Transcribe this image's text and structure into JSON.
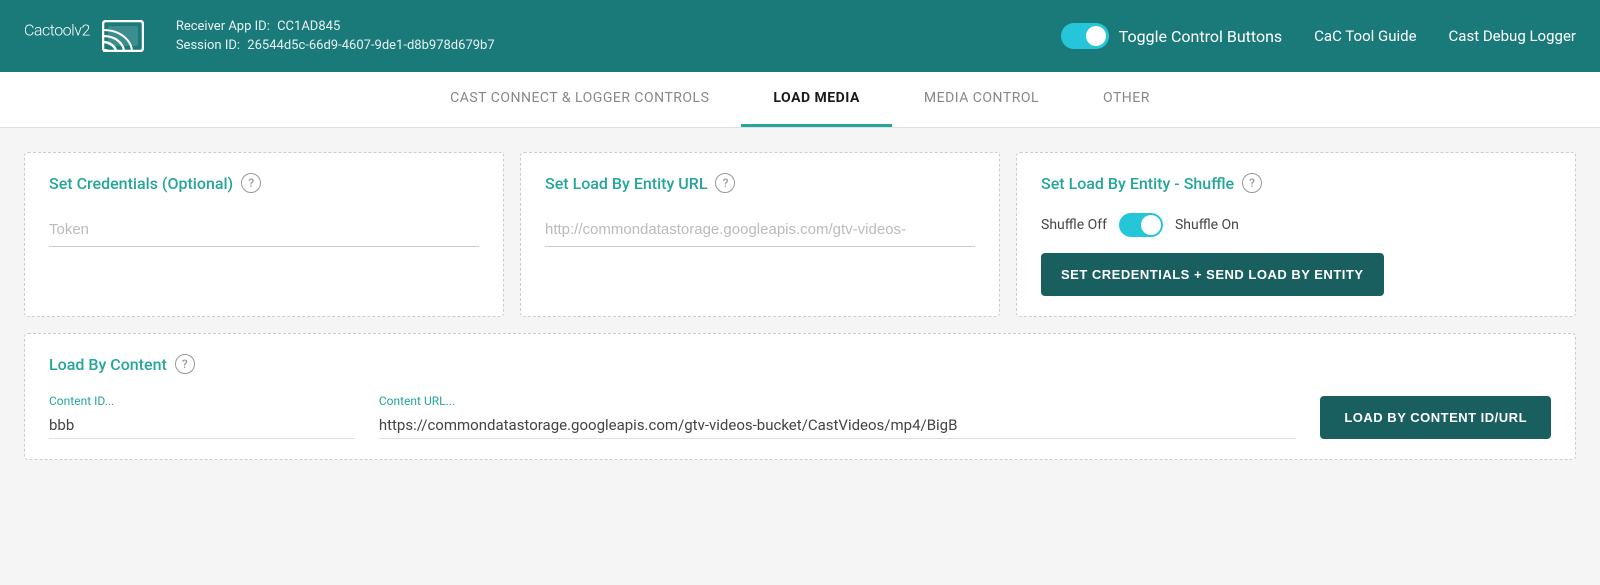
{
  "header": {
    "logo_text": "Cactool",
    "logo_version": "v2",
    "receiver_app_label": "Receiver App ID:",
    "receiver_app_id": "CC1AD845",
    "session_label": "Session ID:",
    "session_id": "26544d5c-66d9-4607-9de1-d8b978d679b7",
    "toggle_label": "Toggle Control Buttons",
    "nav_links": [
      {
        "label": "CaC Tool Guide"
      },
      {
        "label": "Cast Debug Logger"
      }
    ]
  },
  "tabs": [
    {
      "label": "CAST CONNECT & LOGGER CONTROLS",
      "active": false
    },
    {
      "label": "LOAD MEDIA",
      "active": true
    },
    {
      "label": "MEDIA CONTROL",
      "active": false
    },
    {
      "label": "OTHER",
      "active": false
    }
  ],
  "cards_row": [
    {
      "id": "credentials",
      "title": "Set Credentials (Optional)",
      "input_placeholder": "Token"
    },
    {
      "id": "entity_url",
      "title": "Set Load By Entity URL",
      "input_placeholder": "http://commondatastorage.googleapis.com/gtv-videos-"
    },
    {
      "id": "shuffle",
      "title": "Set Load By Entity - Shuffle",
      "shuffle_off_label": "Shuffle Off",
      "shuffle_on_label": "Shuffle On",
      "button_label": "SET CREDENTIALS + SEND LOAD BY ENTITY"
    }
  ],
  "load_by_content": {
    "title": "Load By Content",
    "content_id_label": "Content ID...",
    "content_id_value": "bbb",
    "content_url_label": "Content URL...",
    "content_url_value": "https://commondatastorage.googleapis.com/gtv-videos-bucket/CastVideos/mp4/BigB",
    "button_label": "LOAD BY CONTENT ID/URL"
  }
}
